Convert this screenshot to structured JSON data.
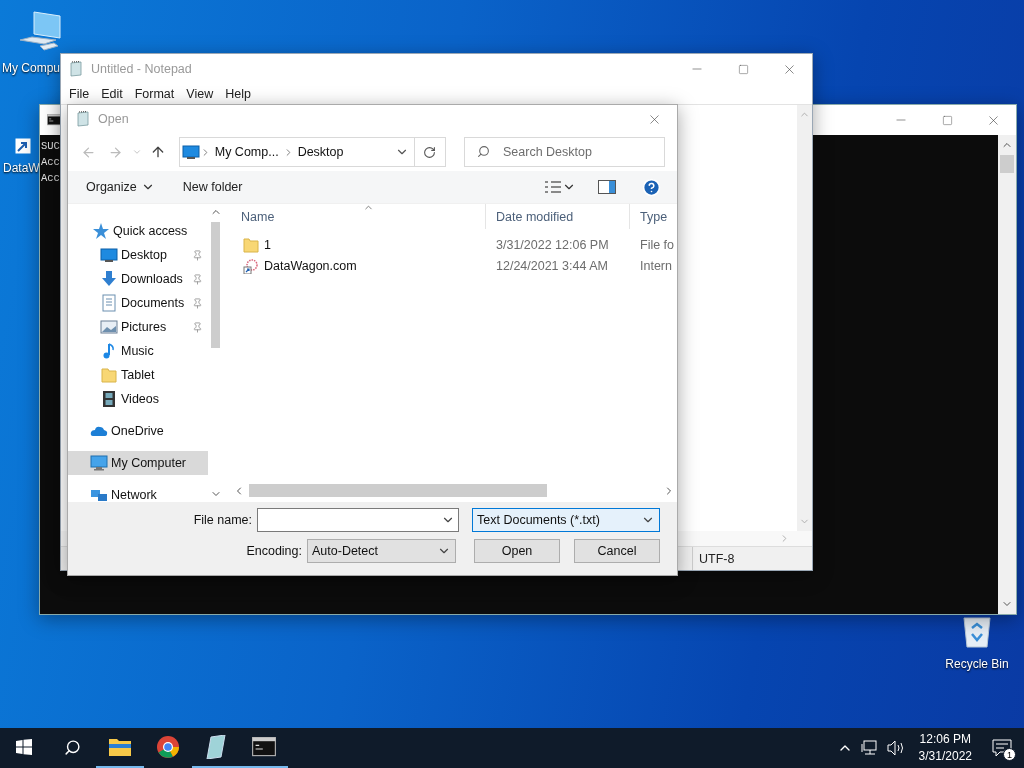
{
  "desktop_icons": [
    {
      "kind": "computer",
      "label": "My Compu"
    },
    {
      "kind": "shortcut",
      "label": "DataW"
    },
    {
      "kind": "recycle",
      "label": "Recycle Bin"
    }
  ],
  "console": {
    "lines": [
      "SUC",
      "Acc",
      "Acc"
    ]
  },
  "notepad": {
    "title": "Untitled - Notepad",
    "menu": [
      "File",
      "Edit",
      "Format",
      "View",
      "Help"
    ],
    "encoding": "UTF-8"
  },
  "dialog": {
    "title": "Open",
    "breadcrumb": [
      "My Comp...",
      "Desktop"
    ],
    "search": {
      "placeholder": "Search Desktop"
    },
    "toolbar": {
      "organize": "Organize",
      "new_folder": "New folder"
    },
    "sidebar": [
      {
        "label": "Quick access",
        "kind": "star",
        "selected": false,
        "children": [
          {
            "label": "Desktop",
            "kind": "desktop",
            "selected": false,
            "pinned": true
          },
          {
            "label": "Downloads",
            "kind": "download",
            "selected": false,
            "pinned": true
          },
          {
            "label": "Documents",
            "kind": "document",
            "selected": false,
            "pinned": true
          },
          {
            "label": "Pictures",
            "kind": "pictures",
            "selected": false,
            "pinned": true
          },
          {
            "label": "Music",
            "kind": "music",
            "selected": false,
            "pinned": false
          },
          {
            "label": "Tablet",
            "kind": "folder",
            "selected": false,
            "pinned": false
          },
          {
            "label": "Videos",
            "kind": "video",
            "selected": false,
            "pinned": false
          }
        ]
      },
      {
        "label": "OneDrive",
        "kind": "cloud",
        "selected": false
      },
      {
        "label": "My Computer",
        "kind": "computer",
        "selected": true
      },
      {
        "label": "Network",
        "kind": "network",
        "selected": false
      }
    ],
    "columns": [
      "Name",
      "Date modified",
      "Type"
    ],
    "files": [
      {
        "kind": "folder",
        "name": "1",
        "date": "3/31/2022 12:06 PM",
        "type": "File fo"
      },
      {
        "kind": "shortcut",
        "name": "DataWagon.com",
        "date": "12/24/2021 3:44 AM",
        "type": "Intern"
      }
    ],
    "file_name": {
      "label": "File name:"
    },
    "file_type": "Text Documents (*.txt)",
    "encoding": {
      "label": "Encoding:",
      "value": "Auto-Detect"
    },
    "buttons": [
      "Open",
      "Cancel"
    ]
  },
  "taskbar": {
    "apps": [
      {
        "kind": "explorer",
        "running": true
      },
      {
        "kind": "chrome",
        "running": false
      },
      {
        "kind": "notepad",
        "running": true
      },
      {
        "kind": "terminal",
        "running": true
      }
    ],
    "time": "12:06 PM",
    "date": "3/31/2022",
    "notifications": "1"
  }
}
